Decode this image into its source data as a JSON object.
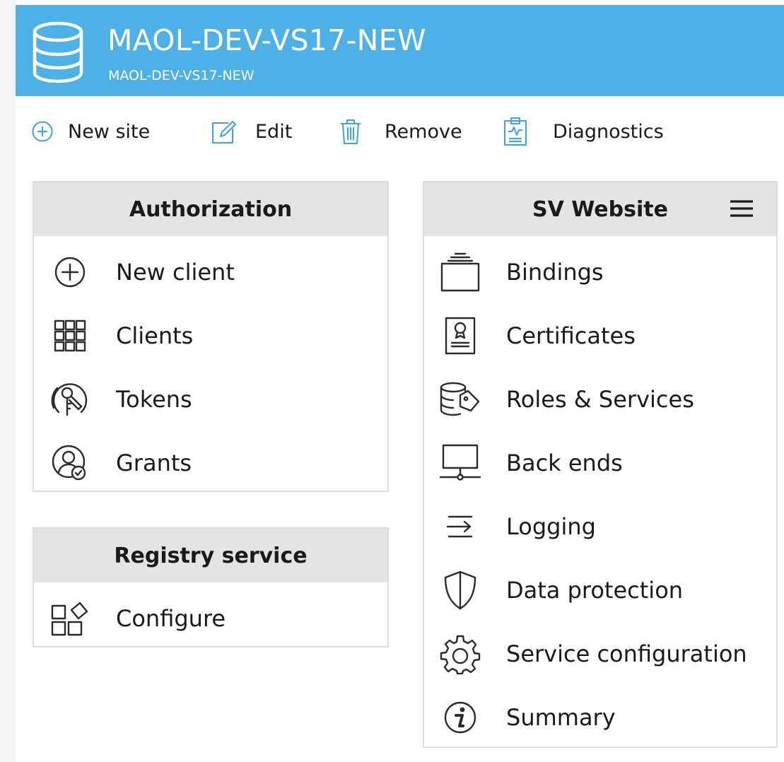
{
  "header": {
    "title": "MAOL-DEV-VS17-NEW",
    "subtitle": "MAOL-DEV-VS17-NEW",
    "icon": "database-icon",
    "color": "#4db1e8"
  },
  "toolbar": {
    "new_site": "New site",
    "edit": "Edit",
    "remove": "Remove",
    "diagnostics": "Diagnostics"
  },
  "authorization": {
    "title": "Authorization",
    "items": [
      {
        "label": "New client",
        "icon": "plus-circle-icon"
      },
      {
        "label": "Clients",
        "icon": "grid-icon"
      },
      {
        "label": "Tokens",
        "icon": "key-circle-icon"
      },
      {
        "label": "Grants",
        "icon": "user-check-icon"
      }
    ]
  },
  "registry": {
    "title": "Registry service",
    "items": [
      {
        "label": "Configure",
        "icon": "configure-blocks-icon"
      }
    ]
  },
  "website": {
    "title": "SV Website",
    "items": [
      {
        "label": "Bindings",
        "icon": "bindings-icon"
      },
      {
        "label": "Certificates",
        "icon": "certificate-icon"
      },
      {
        "label": "Roles & Services",
        "icon": "roles-services-icon"
      },
      {
        "label": "Back ends",
        "icon": "network-monitor-icon"
      },
      {
        "label": "Logging",
        "icon": "logging-icon"
      },
      {
        "label": "Data protection",
        "icon": "shield-icon"
      },
      {
        "label": "Service configuration",
        "icon": "gear-icon"
      },
      {
        "label": "Summary",
        "icon": "info-icon"
      }
    ]
  }
}
